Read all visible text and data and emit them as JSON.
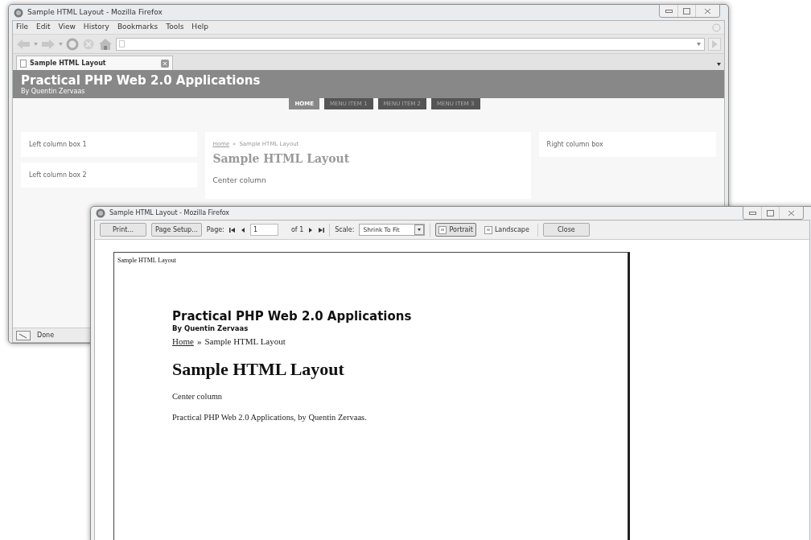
{
  "browser_window": {
    "title": "Sample HTML Layout - Mozilla Firefox",
    "menu": [
      "File",
      "Edit",
      "View",
      "History",
      "Bookmarks",
      "Tools",
      "Help"
    ],
    "tabs": [
      {
        "label": "Sample HTML Layout",
        "selected": true
      }
    ],
    "page": {
      "site_title": "Practical PHP Web 2.0 Applications",
      "byline": "By Quentin Zervaas",
      "nav": [
        {
          "label": "HOME",
          "selected": true
        },
        {
          "label": "MENU ITEM 1",
          "selected": false
        },
        {
          "label": "MENU ITEM 2",
          "selected": false
        },
        {
          "label": "MENU ITEM 3",
          "selected": false
        }
      ],
      "left_boxes": [
        "Left column box 1",
        "Left column box 2"
      ],
      "breadcrumb": {
        "link": "Home",
        "separator": "»",
        "current": "Sample HTML Layout"
      },
      "heading": "Sample HTML Layout",
      "body": "Center column",
      "right_box": "Right column box"
    },
    "status": "Done"
  },
  "print_preview_window": {
    "title": "Sample HTML Layout - Mozilla Firefox",
    "toolbar": {
      "print": "Print...",
      "page_setup": "Page Setup...",
      "page_label": "Page:",
      "page_value": "1",
      "of": "of 1",
      "scale_label": "Scale:",
      "scale_value": "Shrink To Fit",
      "orientations": [
        {
          "label": "Portrait",
          "selected": true
        },
        {
          "label": "Landscape",
          "selected": false
        }
      ],
      "close": "Close"
    },
    "paper": {
      "header": "Sample HTML Layout",
      "site_title": "Practical PHP Web 2.0 Applications",
      "byline": "By Quentin Zervaas",
      "breadcrumb": {
        "link": "Home",
        "separator": "»",
        "current": "Sample HTML Layout"
      },
      "heading": "Sample HTML Layout",
      "paragraphs": [
        "Center column",
        "Practical PHP Web 2.0 Applications, by Quentin Zervaas."
      ]
    }
  }
}
